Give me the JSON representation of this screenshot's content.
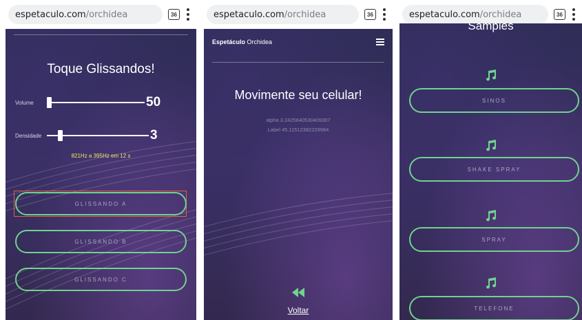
{
  "browser": {
    "domain": "espetaculo.com",
    "path": "/orchidea",
    "tab_count": "36"
  },
  "screen_glissandos": {
    "title": "Toque Glissandos!",
    "volume_label": "Volume",
    "volume_value": "50",
    "density_label": "Densidade",
    "density_value": "3",
    "frequency_text": "821Hz a 395Hz em 12 s",
    "buttons": [
      "GLISSANDO A",
      "GLISSANDO B",
      "GLISSANDO C"
    ]
  },
  "screen_sensor": {
    "brand_bold": "Espetáculo",
    "brand_rest": " Orchidea",
    "title": "Movimente seu celular!",
    "alpha_text": "alpha 3.2425640530409307",
    "label_text": "Label 45.11512382229984",
    "back_label": "Voltar"
  },
  "screen_samples": {
    "title": "Samples",
    "items": [
      "SINOS",
      "SHAKE SPRAY",
      "SPRAY",
      "TELEFONE"
    ]
  },
  "colors": {
    "accent_border": "#6fd48e",
    "selection_frame": "#e0653b",
    "frequency_text": "#f2e75c",
    "background": "#342c5a"
  }
}
